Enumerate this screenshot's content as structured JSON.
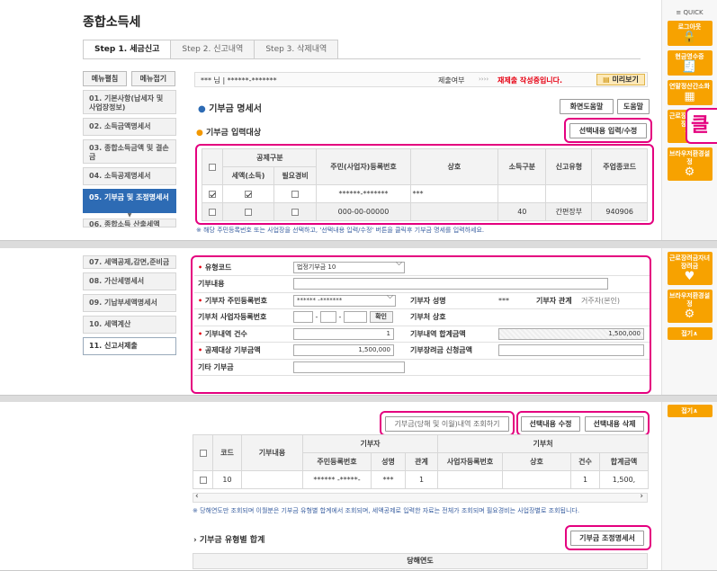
{
  "title": "종합소득세",
  "tabs": [
    "Step 1. 세금신고",
    "Step 2. 신고내역",
    "Step 3. 삭제내역"
  ],
  "menu_buttons": {
    "open": "메뉴펼침",
    "close": "메뉴접기"
  },
  "side_items": [
    "01. 기본사항(납세자 및 사업장정보)",
    "02. 소득금액명세서",
    "03. 종합소득금액 및 결손금",
    "04. 소득공제명세서",
    "05. 기부금 및 조정명세서",
    "06. 종합소득 산출세액"
  ],
  "side_items2": [
    "07. 세액공제,감면,준비금",
    "08. 가산세명세서",
    "09. 기납부세액명세서",
    "10. 세액계산",
    "11. 신고서제출"
  ],
  "user": {
    "name": "*** 님 | ******-*******",
    "status_label": "제출여부",
    "status_arrows": "››››",
    "status_value": "재제출 작성중입니다.",
    "preview": "미리보기"
  },
  "quick": {
    "header": "≡ QUICK",
    "items": [
      {
        "label": "로그아웃",
        "icon": "🔒"
      },
      {
        "label": "현금영수증",
        "icon": "🧾"
      },
      {
        "label": "연말정산간소화",
        "icon": "▦"
      },
      {
        "label": "근로장려금자녀장려금",
        "icon": "♥"
      },
      {
        "label": "브라우저환경설정",
        "icon": "⚙"
      }
    ],
    "items2": [
      {
        "label": "근로장려금자녀장려금",
        "icon": "♥"
      },
      {
        "label": "브라우저환경설정",
        "icon": "⚙"
      }
    ],
    "top": "접기∧"
  },
  "section1": {
    "title": "기부금 명세서",
    "help1": "화면도움말",
    "help2": "도움말",
    "sub": "기부금 입력대상",
    "edit_btn": "선택내용 입력/수정",
    "callout": "클"
  },
  "table1": {
    "headers": [
      "공제구분",
      "주민(사업자)등록번호",
      "상호",
      "소득구분",
      "신고유형",
      "주업종코드"
    ],
    "sub_headers": [
      "세액(소득)",
      "필요경비"
    ],
    "rows": [
      {
        "id": "******-*******",
        "name": "***",
        "income": "",
        "type": "",
        "code": "",
        "c0": true,
        "c1": true,
        "c2": false
      },
      {
        "id": "000-00-00000",
        "name": "",
        "income": "40",
        "type": "간편장부",
        "code": "940906",
        "c0": false,
        "c1": false,
        "c2": false
      }
    ],
    "note": "※ 해당 주민등록번호 또는 사업장을 선택하고, '선택내용 입력/수정' 버튼을 클릭후 기부금 명세를 입력하세요."
  },
  "form": {
    "type_code_label": "유형코드",
    "type_code_value": "법정기부금 10",
    "content_label": "기부내용",
    "donor_id_label": "기부자 주민등록번호",
    "donor_id_value": "****** -*******",
    "donor_name_label": "기부자 성명",
    "donor_name_value": "***",
    "relation_label": "기부자 관계",
    "relation_value": "거주자(본인)",
    "org_id_label": "기부처 사업자등록번호",
    "confirm": "확인",
    "org_name_label": "기부처 상호",
    "count_label": "기부내역 건수",
    "count_value": "1",
    "total_label": "기부내역 합계금액",
    "total_value": "1,500,000",
    "deduct_label": "공제대상 기부금액",
    "deduct_value": "1,500,000",
    "apply_label": "기부장려금 신청금액",
    "other_label": "기타 기부금"
  },
  "section3": {
    "query_btn": "기부금(당해 및 이월)내역 조회하기",
    "edit_btn": "선택내용 수정",
    "delete_btn": "선택내용 삭제",
    "headers": [
      "코드",
      "기부내용",
      "기부자",
      "기부처"
    ],
    "sub_headers": [
      "주민등록번호",
      "성명",
      "관계",
      "사업자등록번호",
      "상호",
      "건수",
      "합계금액"
    ],
    "row": [
      "10",
      "",
      "****** -*****-",
      "***",
      "1",
      "",
      "",
      "1",
      "1,500,"
    ],
    "note": "※ 당해연도만 조회되며 이월분은 기부금 유형별 합계에서 조회되며, 세액공제로 입력한 자료는 전체가 조회되며 필요경비는 사업장별로 조회됩니다.",
    "sum_title": "기부금 유형별 합계",
    "adjust_btn": "기부금 조정명세서",
    "year_head": "당해연도"
  }
}
